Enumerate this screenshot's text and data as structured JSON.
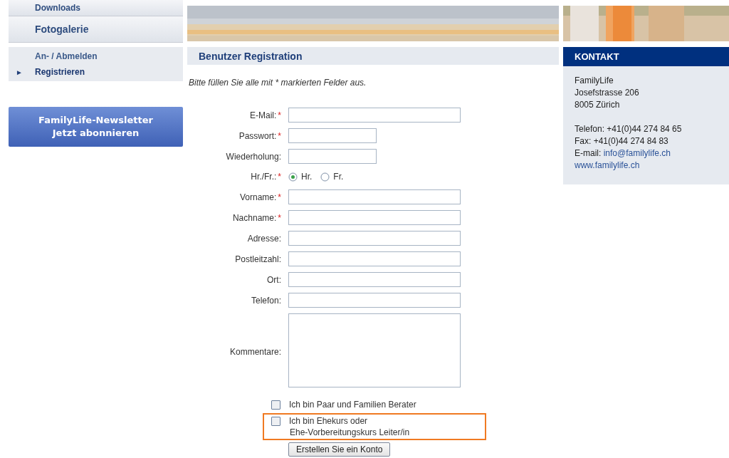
{
  "nav": {
    "items": [
      {
        "label": "Downloads"
      },
      {
        "label": "Fotogalerie"
      }
    ],
    "subitems": [
      {
        "label": "An- / Abmelden",
        "selected": false
      },
      {
        "label": "Registrieren",
        "selected": true
      }
    ],
    "subitem_marker": "►",
    "newsletter": {
      "line1": "FamilyLife-Newsletter",
      "line2": "Jetzt abonnieren"
    }
  },
  "registration": {
    "title": "Benutzer Registration",
    "intro": "Bitte füllen Sie alle mit * markierten Felder aus.",
    "fields": [
      {
        "kind": "long",
        "label": "E-Mail:",
        "required": true
      },
      {
        "kind": "short",
        "label": "Passwort:",
        "required": true
      },
      {
        "kind": "short",
        "label": "Wiederholung:",
        "required": false
      },
      {
        "kind": "radio",
        "label": "Hr./Fr.:",
        "required": true,
        "options": [
          {
            "label": "Hr.",
            "selected": true
          },
          {
            "label": "Fr.",
            "selected": false
          }
        ]
      },
      {
        "kind": "long",
        "label": "Vorname:",
        "required": true
      },
      {
        "kind": "long",
        "label": "Nachname:",
        "required": true
      },
      {
        "kind": "long",
        "label": "Adresse:",
        "required": false
      },
      {
        "kind": "long",
        "label": "Postleitzahl:",
        "required": false
      },
      {
        "kind": "long",
        "label": "Ort:",
        "required": false
      },
      {
        "kind": "long",
        "label": "Telefon:",
        "required": false
      },
      {
        "kind": "area",
        "label": "Kommentare:",
        "required": false
      }
    ],
    "required_mark": "*",
    "checkboxes": [
      {
        "label": "Ich bin Paar und Familien Berater",
        "checked": false,
        "highlighted": false
      },
      {
        "label": "Ich bin Ehekurs oder",
        "label_2": "Ehe-Vorbereitungskurs Leiter/in",
        "checked": false,
        "highlighted": true
      }
    ],
    "submit": "Erstellen Sie ein Konto"
  },
  "contact": {
    "title": "KONTAKT",
    "address": [
      "FamilyLife",
      "Josefstrasse 206",
      "8005 Zürich"
    ],
    "phone": "Telefon: +41(0)44 274 84 65",
    "fax": "Fax: +41(0)44 274 84 83",
    "email_label": "E-mail:",
    "email": "info@familylife.ch",
    "web": "www.familylife.ch"
  }
}
